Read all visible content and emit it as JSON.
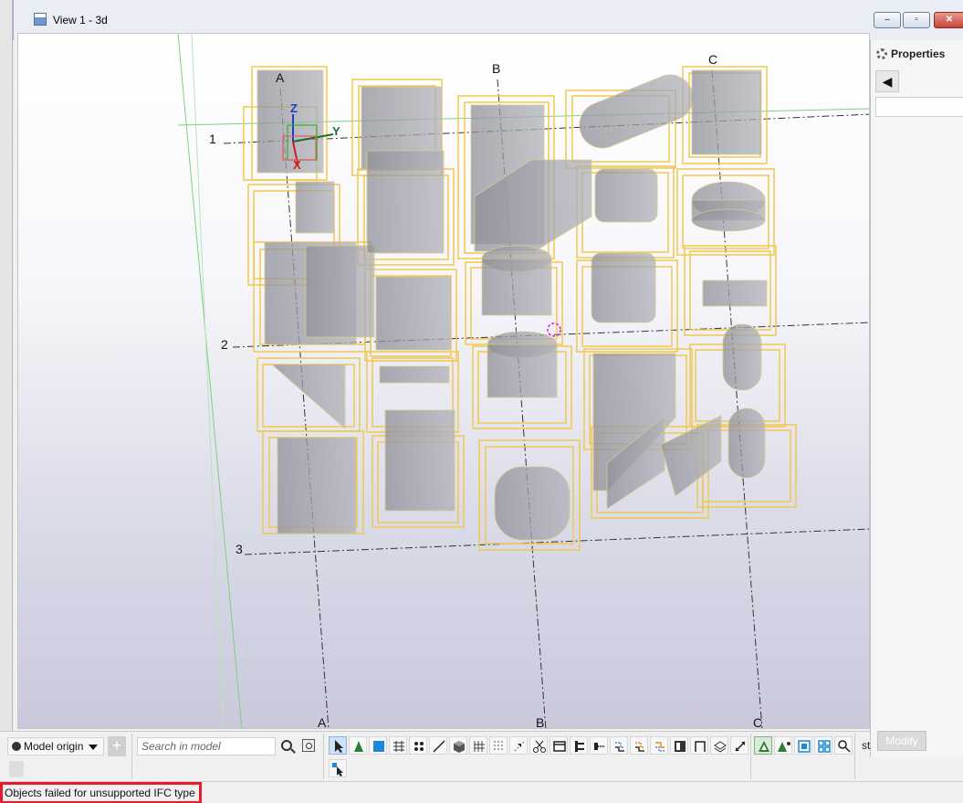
{
  "window": {
    "title": "View 1 - 3d",
    "buttons": {
      "minimize": "‒",
      "maximize": "▫",
      "close": "✕"
    }
  },
  "viewport": {
    "grid_labels": [
      "A",
      "B",
      "C",
      "1",
      "2",
      "3"
    ],
    "bottom_labels": [
      "A",
      "B",
      "C"
    ],
    "axes": {
      "z": "Z",
      "y": "Y",
      "x": "X"
    },
    "colors": {
      "selection": "#f2c84b",
      "object_fill": "#9a9aa3",
      "axis_z": "#1f3fbf",
      "axis_y": "#1f6b2a",
      "axis_x": "#c81e1e"
    }
  },
  "properties": {
    "title": "Properties",
    "back_icon": "◀",
    "modify_label": "Modify"
  },
  "toolbar": {
    "origin_label": "Model origin",
    "add_label": "+",
    "search_placeholder": "Search in model",
    "more_label": "st"
  },
  "status": {
    "message": "Objects failed for unsupported IFC type"
  }
}
